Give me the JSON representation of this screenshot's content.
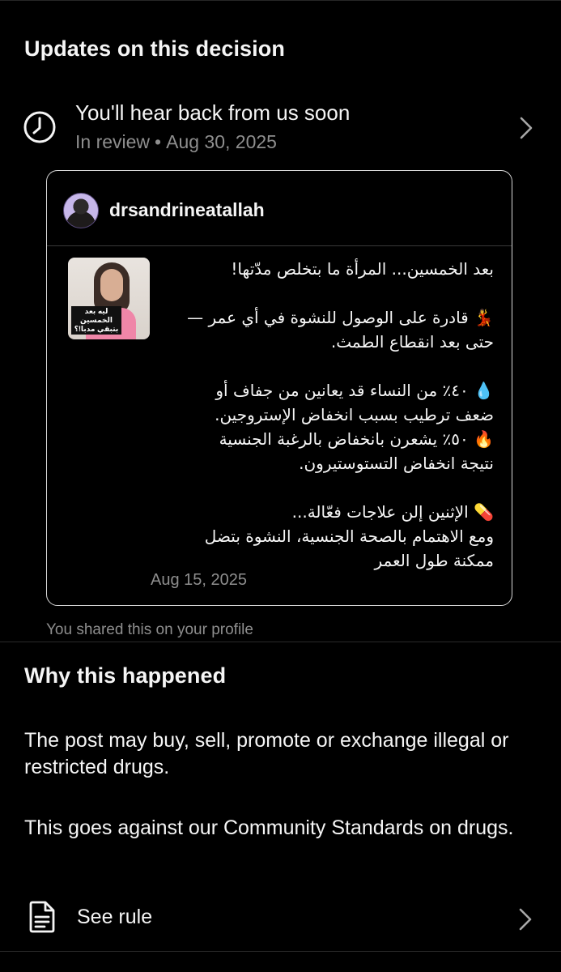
{
  "updates": {
    "title": "Updates on this decision",
    "status_title": "You'll hear back from us soon",
    "status_state": "In review",
    "status_separator": "•",
    "status_date": "Aug 30, 2025",
    "icon": "clock-icon"
  },
  "post": {
    "username": "drsandrineatallah",
    "thumbnail_caption": "ليه بعد الخمسين بتبقي مدبا!؟",
    "text": "بعد الخمسين... المرأة ما بتخلص مدّتها!\n\n💃 قادرة على الوصول للنشوة في أي عمر —\nحتى بعد انقطاع الطمث.\n\n💧 ٤٠٪ من النساء قد يعانين من جفاف أو\nضعف ترطيب بسبب انخفاض الإستروجين.\n🔥 ٥٠٪ يشعرن بانخفاض بالرغبة الجنسية\nنتيجة انخفاض التستوستيرون.\n\n💊 الإثنين إلن علاجات فعّالة...\nومع الاهتمام بالصحة الجنسية، النشوة بتضل\nممكنة طول العمر",
    "date": "Aug 15, 2025"
  },
  "shared_note": "You shared this on your profile",
  "why": {
    "title": "Why this happened",
    "reason_1": "The post may buy, sell, promote or exchange illegal or restricted drugs.",
    "reason_2": "This goes against our Community Standards on drugs.",
    "see_rule_label": "See rule",
    "icon": "document-icon"
  },
  "colors": {
    "background": "#000000",
    "text_primary": "#f5f5f5",
    "text_secondary": "#8e8e8e",
    "card_border": "#d8d8d8"
  }
}
